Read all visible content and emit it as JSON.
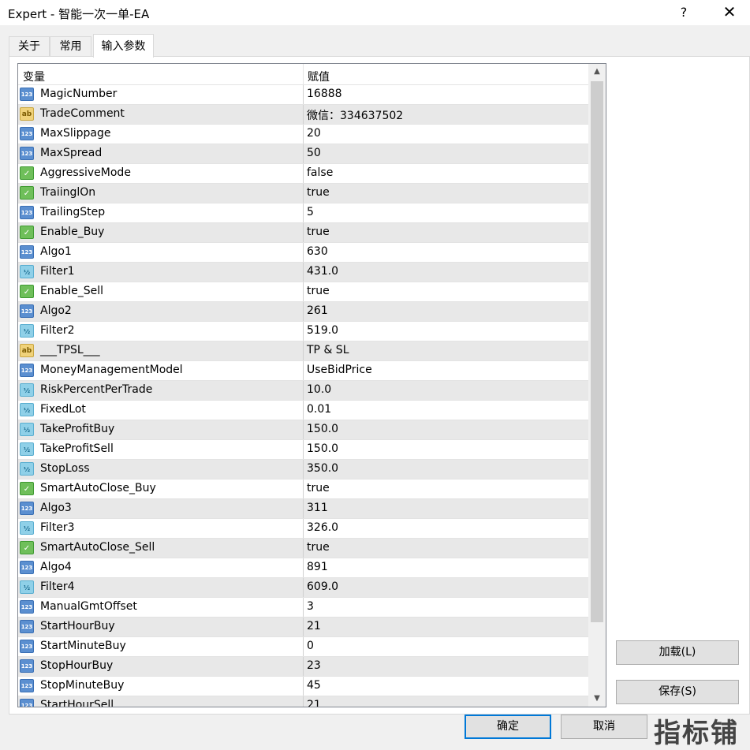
{
  "window": {
    "title": "Expert - 智能一次一单-EA",
    "help": "?",
    "close": "✕"
  },
  "tabs": [
    "关于",
    "常用",
    "输入参数"
  ],
  "grid": {
    "col_variable": "变量",
    "col_value": "赋值",
    "rows": [
      {
        "type": "int",
        "name": "MagicNumber",
        "value": "16888"
      },
      {
        "type": "str",
        "name": "TradeComment",
        "value": "微信：334637502"
      },
      {
        "type": "int",
        "name": "MaxSlippage",
        "value": "20"
      },
      {
        "type": "int",
        "name": "MaxSpread",
        "value": "50"
      },
      {
        "type": "bool",
        "name": "AggressiveMode",
        "value": "false"
      },
      {
        "type": "bool",
        "name": "TraiinglOn",
        "value": "true"
      },
      {
        "type": "int",
        "name": "TrailingStep",
        "value": "5"
      },
      {
        "type": "bool",
        "name": "Enable_Buy",
        "value": "true"
      },
      {
        "type": "int",
        "name": "Algo1",
        "value": "630"
      },
      {
        "type": "dbl",
        "name": "Filter1",
        "value": "431.0"
      },
      {
        "type": "bool",
        "name": "Enable_Sell",
        "value": "true"
      },
      {
        "type": "int",
        "name": "Algo2",
        "value": "261"
      },
      {
        "type": "dbl",
        "name": "Filter2",
        "value": "519.0"
      },
      {
        "type": "str",
        "name": "___TPSL___",
        "value": "TP & SL"
      },
      {
        "type": "int",
        "name": "MoneyManagementModel",
        "value": "UseBidPrice"
      },
      {
        "type": "dbl",
        "name": "RiskPercentPerTrade",
        "value": "10.0"
      },
      {
        "type": "dbl",
        "name": "FixedLot",
        "value": "0.01"
      },
      {
        "type": "dbl",
        "name": "TakeProfitBuy",
        "value": "150.0"
      },
      {
        "type": "dbl",
        "name": "TakeProfitSell",
        "value": "150.0"
      },
      {
        "type": "dbl",
        "name": "StopLoss",
        "value": "350.0"
      },
      {
        "type": "bool",
        "name": "SmartAutoClose_Buy",
        "value": "true"
      },
      {
        "type": "int",
        "name": "Algo3",
        "value": "311"
      },
      {
        "type": "dbl",
        "name": "Filter3",
        "value": "326.0"
      },
      {
        "type": "bool",
        "name": "SmartAutoClose_Sell",
        "value": "true"
      },
      {
        "type": "int",
        "name": "Algo4",
        "value": "891"
      },
      {
        "type": "dbl",
        "name": "Filter4",
        "value": "609.0"
      },
      {
        "type": "int",
        "name": "ManualGmtOffset",
        "value": "3"
      },
      {
        "type": "int",
        "name": "StartHourBuy",
        "value": "21"
      },
      {
        "type": "int",
        "name": "StartMinuteBuy",
        "value": "0"
      },
      {
        "type": "int",
        "name": "StopHourBuy",
        "value": "23"
      },
      {
        "type": "int",
        "name": "StopMinuteBuy",
        "value": "45"
      },
      {
        "type": "int",
        "name": "StartHourSell",
        "value": "21"
      }
    ]
  },
  "icon_labels": {
    "int": "123",
    "str": "ab",
    "bool": "✓",
    "dbl": "½"
  },
  "buttons": {
    "load": "加载(L)",
    "save": "保存(S)",
    "ok": "确定",
    "cancel": "取消"
  },
  "watermark": "指标铺"
}
